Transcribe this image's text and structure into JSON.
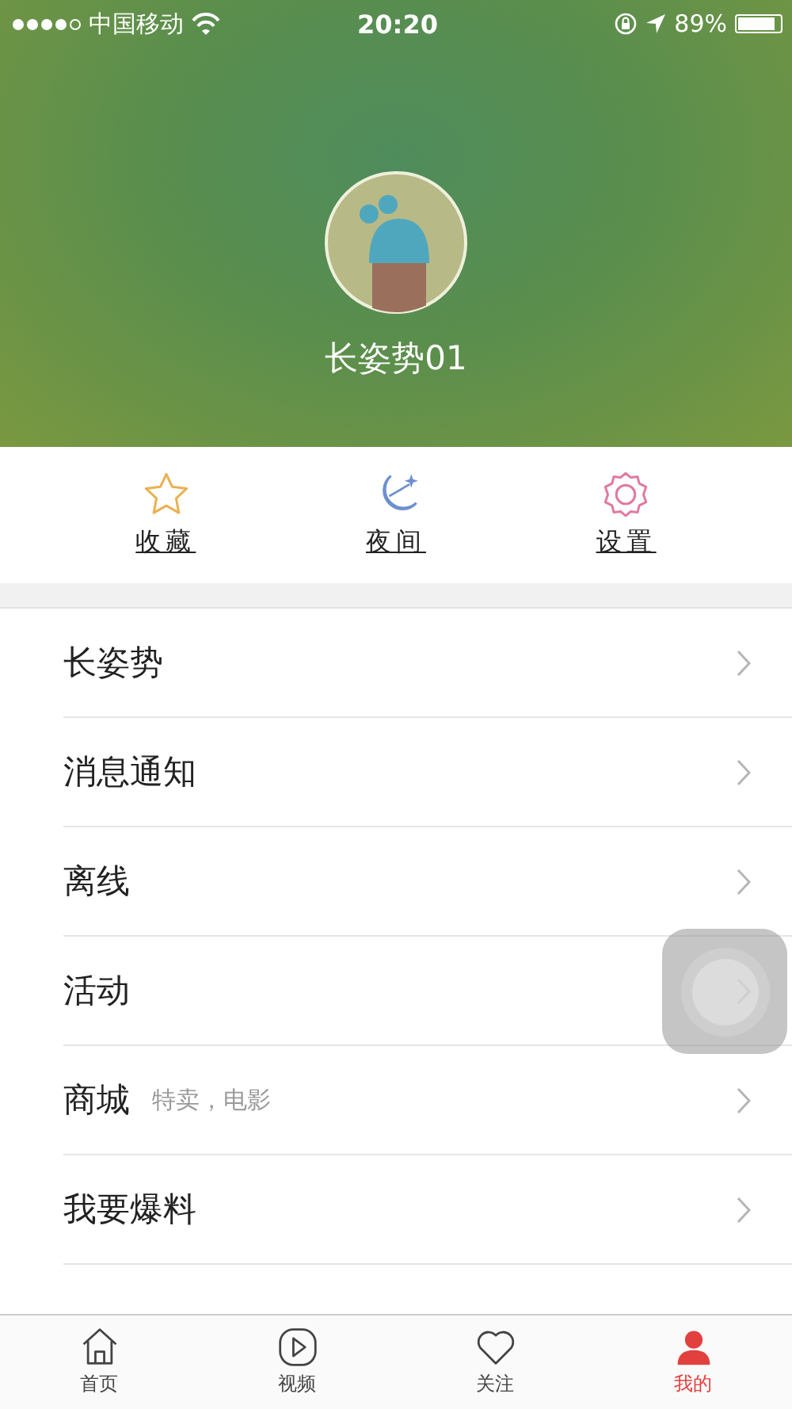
{
  "status_bar": {
    "carrier": "中国移动",
    "time": "20:20",
    "battery": "89%"
  },
  "profile": {
    "username": "长姿势01"
  },
  "quick_actions": [
    {
      "kind": "star",
      "label": "收藏"
    },
    {
      "kind": "moon",
      "label": "夜间"
    },
    {
      "kind": "gear",
      "label": "设置"
    }
  ],
  "menu": [
    {
      "label": "长姿势"
    },
    {
      "label": "消息通知"
    },
    {
      "label": "离线"
    },
    {
      "label": "活动"
    },
    {
      "label": "商城",
      "note": "特卖，电影"
    },
    {
      "label": "我要爆料"
    }
  ],
  "tab_bar": [
    {
      "kind": "home",
      "label": "首页",
      "selected": false
    },
    {
      "kind": "video",
      "label": "视频",
      "selected": false
    },
    {
      "kind": "heart",
      "label": "关注",
      "selected": false
    },
    {
      "kind": "person",
      "label": "我的",
      "selected": true
    }
  ]
}
